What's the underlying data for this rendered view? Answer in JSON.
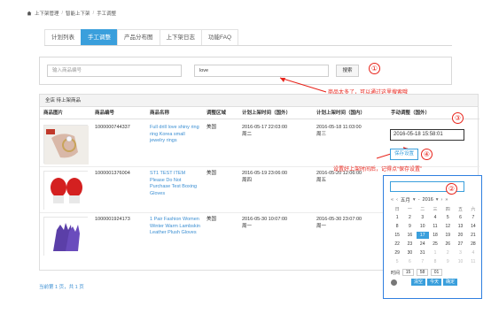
{
  "breadcrumb": [
    "上下架管理",
    "智能上下架",
    "手工调整"
  ],
  "tabs": [
    {
      "label": "计划列表",
      "active": false
    },
    {
      "label": "手工调整",
      "active": true
    },
    {
      "label": "产品分布图",
      "active": false
    },
    {
      "label": "上下架日志",
      "active": false
    },
    {
      "label": "功能FAQ",
      "active": false
    }
  ],
  "search": {
    "sku_placeholder": "输入商品编号",
    "keyword_value": "love",
    "button_label": "搜索"
  },
  "annotations": {
    "c1": "①",
    "c2": "②",
    "c3": "③",
    "c4": "④",
    "note_search": "商品太多了，可以通过这里搜索哦",
    "note_save": "设置好上架时间后，记得点“保存设置”"
  },
  "panel": {
    "title": "全店 待上架商品",
    "headers": [
      "商品图片",
      "商品编号",
      "商品名称",
      "调整区域",
      "计划上架时间（国外）",
      "计划上架时间（国内）",
      "手动调整（国外）"
    ]
  },
  "rows": [
    {
      "id": "1000000744337",
      "name": "Full drill love shiny ring ring Korea small jewelry rings",
      "region": "美国",
      "abroad": "2016-05-17 22:03:00",
      "abroad_day": "周二",
      "home": "2016-05-18 11:03:00",
      "home_day": "周三"
    },
    {
      "id": "1000001376004",
      "name": "ST1 TEST ITEM Please Do Not Purchase Test Boxing Gloves",
      "region": "美国",
      "abroad": "2016-05-19 23:06:00",
      "abroad_day": "周四",
      "home": "2016-05-20 12:06:00",
      "home_day": "周五"
    },
    {
      "id": "1000001924173",
      "name": "1 Pair Fashion Women Winter Warm Lambskin Leather Plush Gloves",
      "region": "美国",
      "abroad": "2016-05-30 10:07:00",
      "abroad_day": "周一",
      "home": "2016-05-30 23:07:00",
      "home_day": "周一"
    }
  ],
  "manual": {
    "value": "2016-05-18 15:58:01",
    "save_label": "保存设置"
  },
  "picker": {
    "prev": "«",
    "prev_m": "‹",
    "month": "五月",
    "year": "2016",
    "next_m": "›",
    "next": "»",
    "weekdays": [
      "日",
      "一",
      "二",
      "三",
      "四",
      "五",
      "六"
    ],
    "days": [
      {
        "d": "1",
        "o": false
      },
      {
        "d": "2",
        "o": false
      },
      {
        "d": "3",
        "o": false
      },
      {
        "d": "4",
        "o": false
      },
      {
        "d": "5",
        "o": false
      },
      {
        "d": "6",
        "o": false
      },
      {
        "d": "7",
        "o": false
      },
      {
        "d": "8",
        "o": false
      },
      {
        "d": "9",
        "o": false
      },
      {
        "d": "10",
        "o": false
      },
      {
        "d": "11",
        "o": false
      },
      {
        "d": "12",
        "o": false
      },
      {
        "d": "13",
        "o": false
      },
      {
        "d": "14",
        "o": false
      },
      {
        "d": "15",
        "o": false
      },
      {
        "d": "16",
        "o": false
      },
      {
        "d": "17",
        "o": false,
        "sel": true
      },
      {
        "d": "18",
        "o": false
      },
      {
        "d": "19",
        "o": false
      },
      {
        "d": "20",
        "o": false
      },
      {
        "d": "21",
        "o": false
      },
      {
        "d": "22",
        "o": false
      },
      {
        "d": "23",
        "o": false
      },
      {
        "d": "24",
        "o": false
      },
      {
        "d": "25",
        "o": false
      },
      {
        "d": "26",
        "o": false
      },
      {
        "d": "27",
        "o": false
      },
      {
        "d": "28",
        "o": false
      },
      {
        "d": "29",
        "o": false
      },
      {
        "d": "30",
        "o": false
      },
      {
        "d": "31",
        "o": false
      },
      {
        "d": "1",
        "o": true
      },
      {
        "d": "2",
        "o": true
      },
      {
        "d": "3",
        "o": true
      },
      {
        "d": "4",
        "o": true
      },
      {
        "d": "5",
        "o": true
      },
      {
        "d": "6",
        "o": true
      },
      {
        "d": "7",
        "o": true
      },
      {
        "d": "8",
        "o": true
      },
      {
        "d": "9",
        "o": true
      },
      {
        "d": "10",
        "o": true
      },
      {
        "d": "11",
        "o": true
      }
    ],
    "time_label": "时间",
    "hh": "15",
    "mm": "58",
    "ss": "01",
    "clear": "清空",
    "today": "今天",
    "ok": "确定"
  },
  "footer": "当前第 1 页，共 1 页",
  "colors": {
    "accent": "#3a9fdc",
    "annotation": "#e8231a",
    "highlight_box": "#2f7fdf"
  }
}
